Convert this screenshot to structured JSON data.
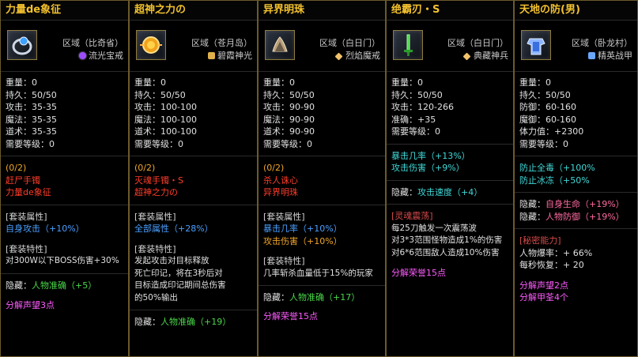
{
  "panels": [
    {
      "title": "力量de象征",
      "region": "区域（比奇省）",
      "set_icon": "purple-swirl-icon",
      "set_name": "流光宝戒",
      "stats": [
        "重量：0",
        "持久：50/50",
        "攻击：35-35",
        "魔法：35-35",
        "道术：35-35",
        "需要等级：0"
      ],
      "set_progress": "(0/2)",
      "set_items": [
        "赶尸手镯",
        "力量de象征"
      ],
      "set_attr_header": "[套装属性]",
      "set_attr_line": "自身攻击（+10%）",
      "set_feat_header": "[套装特性]",
      "set_feat_line": "对300W以下BOSS伤害+30%",
      "hidden_label": "隐藏：",
      "hidden_value": "人物准确（+5）",
      "decompose": "分解声望3点"
    },
    {
      "title": "超神之力の",
      "region": "区域（苍月岛）",
      "set_icon": "gold-emblem-icon",
      "set_name": "碧霞神光",
      "stats": [
        "重量：0",
        "持久：50/50",
        "攻击：100-100",
        "魔法：100-100",
        "道术：100-100",
        "需要等级：0"
      ],
      "set_progress": "(0/2)",
      "set_items": [
        "灭魂手镯・S",
        "超神之力の"
      ],
      "set_attr_header": "[套装属性]",
      "set_attr_line": "全部属性（+28%）",
      "set_feat_header": "[套装特性]",
      "set_feat_lines": [
        "发起攻击对目标释放",
        "死亡印记，将在3秒后对",
        "目标造成印记期间总伤害",
        "的50%输出"
      ],
      "hidden_label": "隐藏：",
      "hidden_value": "人物准确（+19）"
    },
    {
      "title": "异界明珠",
      "region": "区域（白日门）",
      "set_icon": "gold-diamond-icon",
      "set_name": "烈焰魔戒",
      "stats": [
        "重量：0",
        "持久：50/50",
        "攻击：90-90",
        "魔法：90-90",
        "道术：90-90",
        "需要等级：0"
      ],
      "set_progress": "(0/2)",
      "set_items": [
        "杀人诛心",
        "异界明珠"
      ],
      "set_attr_header": "[套装属性]",
      "set_attr_lines": [
        "暴击几率（+10%）",
        "攻击伤害（+10%）"
      ],
      "set_feat_header": "[套装特性]",
      "set_feat_line": "几率斩杀血量低于15%的玩家",
      "hidden_label": "隐藏：",
      "hidden_value": "人物准确（+17）",
      "decompose": "分解荣誉15点"
    },
    {
      "title": "绝霸刃・S",
      "region": "区域（白日门）",
      "set_icon": "gold-diamond-icon",
      "set_name": "典藏神兵",
      "stats": [
        "重量：0",
        "持久：50/50",
        "攻击：120-266",
        "准确：+35",
        "需要等级：0"
      ],
      "crit_lines": [
        "暴击几率（+13%）",
        "攻击伤害（+9%）"
      ],
      "hidden_label": "隐藏：",
      "hidden_value": "攻击速度（+4）",
      "special_header": "[灵魂震荡]",
      "special_lines": [
        "每25刀触发一次震荡波",
        "对3*3范围怪物造成1%的伤害",
        "对6*6范围敌人造成10%伤害"
      ],
      "decompose": "分解荣誉15点"
    },
    {
      "title": "天地の防(男)",
      "region": "区域（卧龙村）",
      "set_icon": "blue-gear-icon",
      "set_name": "精英战甲",
      "stats": [
        "重量：0",
        "持久：50/50",
        "防御：60-160",
        "魔御：60-160",
        "体力值：+2300",
        "需要等级：0"
      ],
      "defense_lines": [
        "防止全毒（+100%",
        "防止冰冻（+50%"
      ],
      "hidden_label": "隐藏：",
      "hidden_values": [
        "自身生命（+19%）",
        "人物防御（+19%）"
      ],
      "secret_header": "[秘密能力]",
      "secret_lines": [
        "人物爆率：+ 66%",
        "每秒恢复：+ 20"
      ],
      "decompose_lines": [
        "分解声望2点",
        "分解甲荃4个"
      ]
    }
  ]
}
